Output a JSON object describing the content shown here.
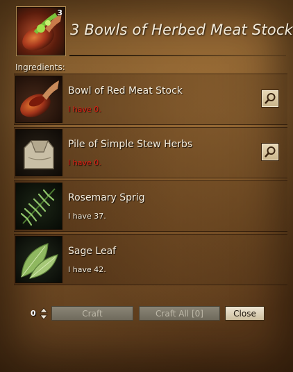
{
  "recipe": {
    "title": "3 Bowls of Herbed Meat Stock",
    "output_quantity_badge": "3",
    "icon": "bowl-of-herbed-meat-stock-icon"
  },
  "ingredients_label": "Ingredients:",
  "ingredients": [
    {
      "name": "Bowl of Red Meat Stock",
      "have_text": "I have 0.",
      "status": "insufficient",
      "icon": "bowl-of-red-meat-stock-icon",
      "has_search": true
    },
    {
      "name": "Pile of Simple Stew Herbs",
      "have_text": "I have 0.",
      "status": "insufficient",
      "icon": "pile-of-simple-stew-herbs-icon",
      "has_search": true
    },
    {
      "name": "Rosemary Sprig",
      "have_text": "I have 37.",
      "status": "sufficient",
      "icon": "rosemary-sprig-icon",
      "has_search": false
    },
    {
      "name": "Sage Leaf",
      "have_text": "I have 42.",
      "status": "sufficient",
      "icon": "sage-leaf-icon",
      "has_search": false
    }
  ],
  "controls": {
    "quantity": "0",
    "craft_label": "Craft",
    "craft_all_label": "Craft All [0]",
    "close_label": "Close"
  },
  "colors": {
    "insufficient": "#e01a12",
    "sufficient": "#f0e9da",
    "title": "#f3ead9"
  }
}
